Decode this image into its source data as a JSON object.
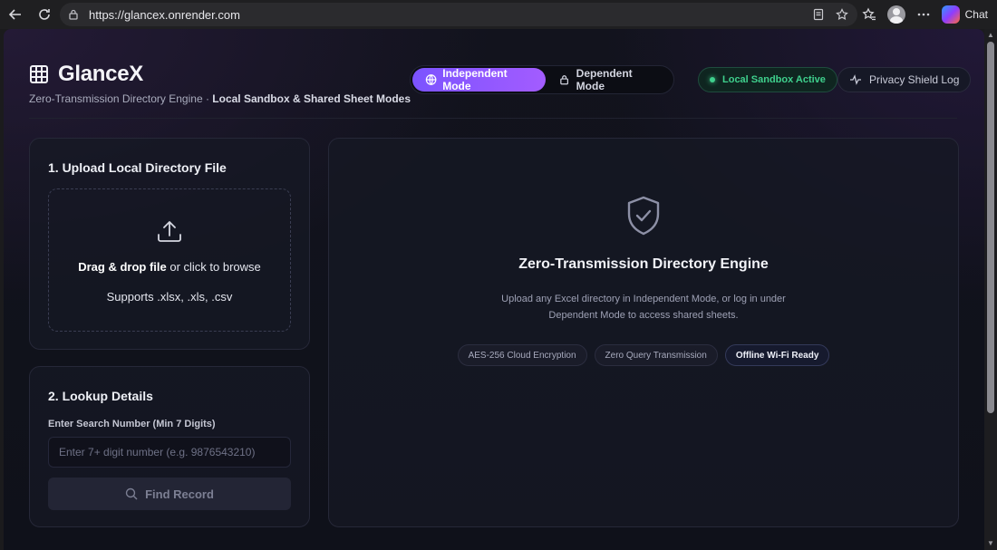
{
  "browser": {
    "url": "https://glancex.onrender.com",
    "chat_label": "Chat"
  },
  "header": {
    "brand_name": "GlanceX",
    "subtitle_prefix": "Zero-Transmission Directory Engine · ",
    "subtitle_bold": "Local Sandbox & Shared Sheet Modes",
    "mode_independent": "Independent Mode",
    "mode_dependent": "Dependent Mode",
    "sandbox_status": "Local Sandbox Active",
    "privacy_log": "Privacy Shield Log"
  },
  "upload": {
    "title": "1. Upload Local Directory File",
    "drop_bold": "Drag & drop file",
    "drop_rest": " or click to browse",
    "supports": "Supports .xlsx, .xls, .csv"
  },
  "lookup": {
    "title": "2. Lookup Details",
    "field_label": "Enter Search Number (Min 7 Digits)",
    "placeholder": "Enter 7+ digit number (e.g. 9876543210)",
    "value": "",
    "button_label": "Find Record"
  },
  "main": {
    "title": "Zero-Transmission Directory Engine",
    "description": "Upload any Excel directory in Independent Mode, or log in under Dependent Mode to access shared sheets.",
    "tags": [
      "AES-256 Cloud Encryption",
      "Zero Query Transmission",
      "Offline Wi-Fi Ready"
    ]
  },
  "colors": {
    "accent": "#8b57ff",
    "status_green": "#3fd08d"
  },
  "icons": [
    "back-icon",
    "reload-icon",
    "lock-icon",
    "reader-icon",
    "star-icon",
    "favorites-icon",
    "profile-icon",
    "more-icon",
    "copilot-icon",
    "grid-icon",
    "globe-icon",
    "lock-icon",
    "pulse-icon",
    "upload-icon",
    "search-icon",
    "shield-check-icon"
  ]
}
